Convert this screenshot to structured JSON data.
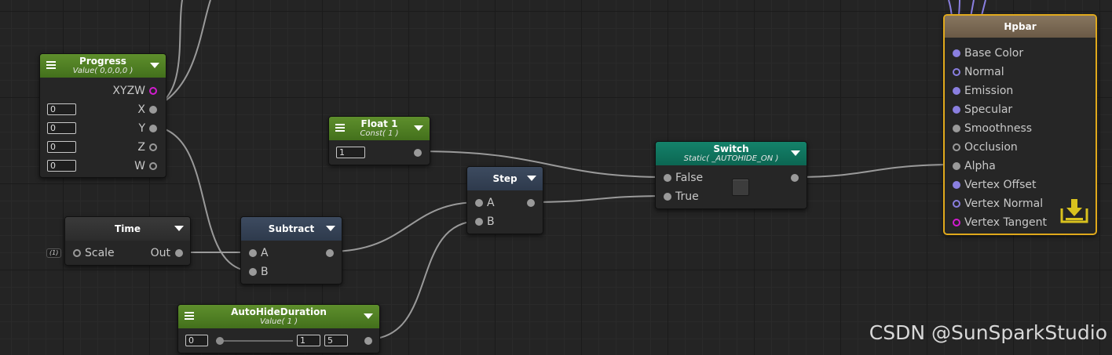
{
  "nodes": {
    "progress": {
      "title": "Progress",
      "subtitle": "Value( 0,0,0,0 )",
      "output": "XYZW",
      "components": [
        {
          "label": "X",
          "value": "0"
        },
        {
          "label": "Y",
          "value": "0"
        },
        {
          "label": "Z",
          "value": "0"
        },
        {
          "label": "W",
          "value": "0"
        }
      ]
    },
    "float1": {
      "title": "Float 1",
      "subtitle": "Const( 1 )",
      "value": "1"
    },
    "time": {
      "title": "Time",
      "scale_tag": "(1)",
      "input": "Scale",
      "output": "Out"
    },
    "subtract": {
      "title": "Subtract",
      "inputs": [
        "A",
        "B"
      ]
    },
    "step": {
      "title": "Step",
      "inputs": [
        "A",
        "B"
      ]
    },
    "autohide": {
      "title": "AutoHideDuration",
      "subtitle": "Value( 1 )",
      "min": "0",
      "value": "1",
      "max": "5",
      "slider_fraction": 0.05
    },
    "switch": {
      "title": "Switch",
      "subtitle": "Static( _AUTOHIDE_ON )",
      "inputs": [
        "False",
        "True"
      ]
    },
    "hpbar": {
      "title": "Hpbar",
      "inputs": [
        "Base Color",
        "Normal",
        "Emission",
        "Specular",
        "Smoothness",
        "Occlusion",
        "Alpha",
        "Vertex Offset",
        "Vertex Normal",
        "Vertex Tangent"
      ]
    }
  },
  "colors": {
    "background": "#242424",
    "value_node_header": "#4f7f24",
    "function_node_header": "#34425a",
    "switch_header": "#108068",
    "master_header": "#7a6852",
    "master_border": "#e0a91c",
    "color_port": "#8a7fe0",
    "vector4_port": "#d21ccf",
    "float_port": "#9a9a9a"
  },
  "icons": [
    "menu-icon",
    "dropdown-arrow-icon",
    "save-output-icon"
  ],
  "watermark": "CSDN @SunSparkStudio"
}
